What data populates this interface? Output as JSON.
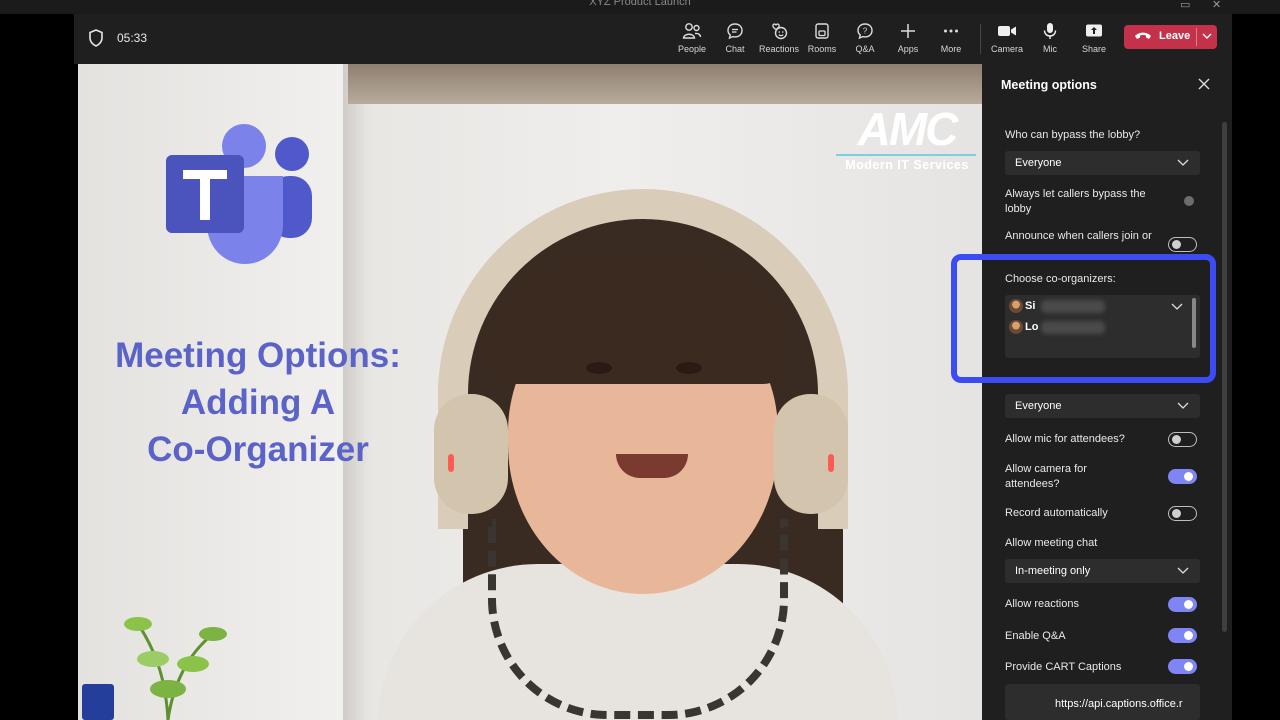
{
  "window": {
    "title": "XYZ Product Launch"
  },
  "toolbar": {
    "timer": "05:33",
    "buttons": [
      {
        "label": "People",
        "icon": "people-icon"
      },
      {
        "label": "Chat",
        "icon": "chat-icon"
      },
      {
        "label": "Reactions",
        "icon": "reactions-icon"
      },
      {
        "label": "Rooms",
        "icon": "rooms-icon"
      },
      {
        "label": "Q&A",
        "icon": "qna-icon"
      },
      {
        "label": "Apps",
        "icon": "plus-icon"
      },
      {
        "label": "More",
        "icon": "more-icon"
      },
      {
        "label": "Camera",
        "icon": "camera-icon"
      },
      {
        "label": "Mic",
        "icon": "mic-icon"
      },
      {
        "label": "Share",
        "icon": "share-icon"
      }
    ],
    "leave_label": "Leave",
    "leave_color": "#c4314b"
  },
  "video": {
    "overlay_lines": [
      "Meeting Options:",
      "Adding A",
      "Co-Organizer"
    ],
    "overlay_color": "#5b63c9",
    "brand_logo": {
      "word": "AMC",
      "subtitle": "Modern IT Services"
    }
  },
  "panel": {
    "title": "Meeting options",
    "bypass_lobby": {
      "label": "Who can bypass the lobby?",
      "value": "Everyone"
    },
    "callers_bypass": {
      "label": "Always let callers bypass the lobby",
      "state": "disabled"
    },
    "announce": {
      "label": "Announce when callers join or leave",
      "on": false
    },
    "coorganizers": {
      "label": "Choose co-organizers:",
      "people": [
        {
          "initials": "Si"
        },
        {
          "initials": "Lo"
        }
      ]
    },
    "presenters": {
      "value": "Everyone"
    },
    "mic": {
      "label": "Allow mic for attendees?",
      "on": false
    },
    "camera": {
      "label": "Allow camera for attendees?",
      "on": true
    },
    "record": {
      "label": "Record automatically",
      "on": false
    },
    "chat": {
      "label": "Allow meeting chat",
      "value": "In-meeting only"
    },
    "reactions": {
      "label": "Allow reactions",
      "on": true
    },
    "qna": {
      "label": "Enable Q&A",
      "on": true
    },
    "cart": {
      "label": "Provide CART Captions",
      "on": true
    },
    "captions_url": "https://api.captions.office.r",
    "accent_color": "#7f85f5",
    "highlight_color": "#3b4cf5"
  }
}
